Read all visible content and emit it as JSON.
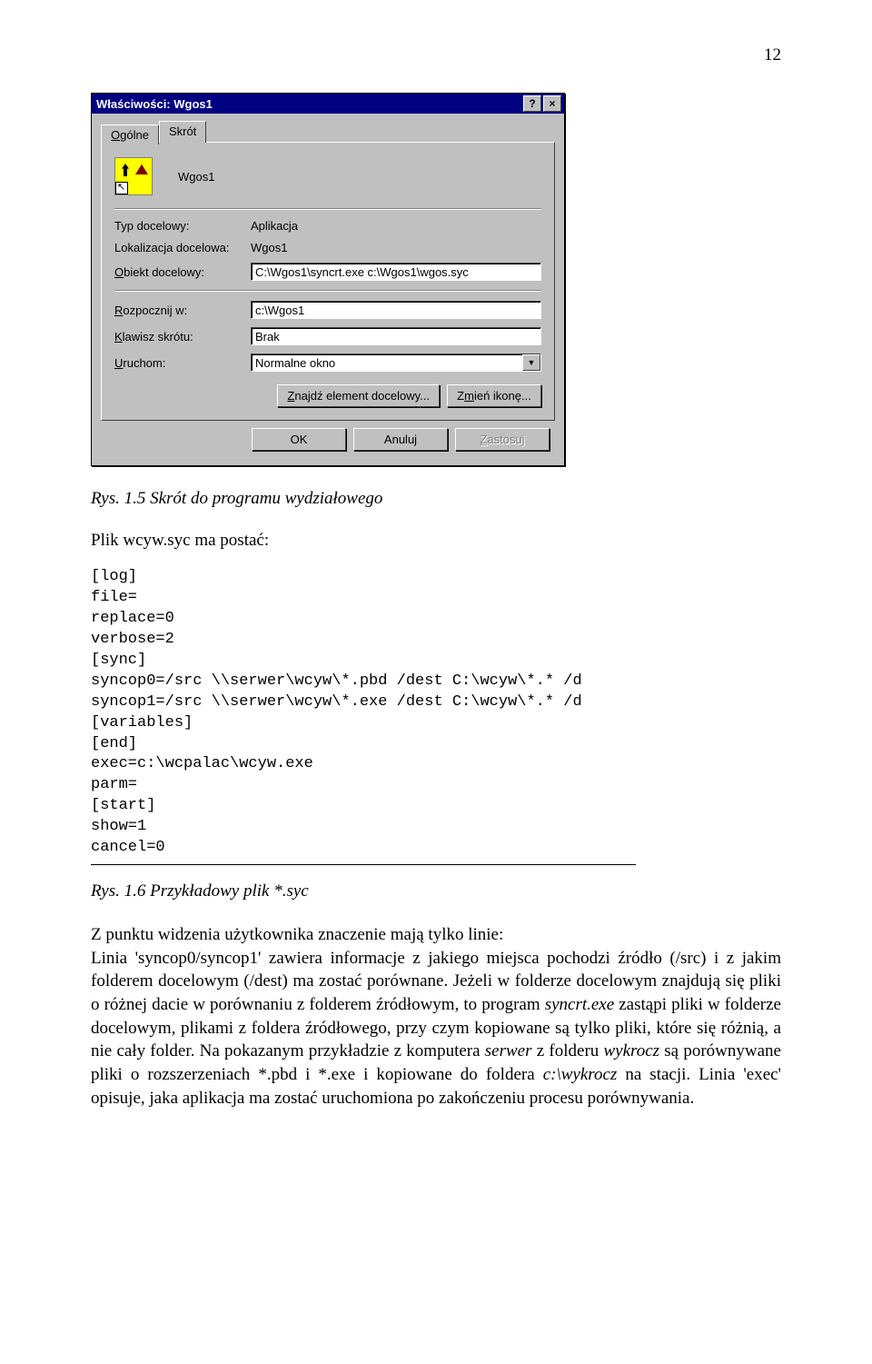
{
  "page_number": "12",
  "dialog": {
    "title": "Właściwości: Wgos1",
    "help_symbol": "?",
    "close_symbol": "×",
    "tabs": {
      "general": "Ogólne",
      "shortcut": "Skrót"
    },
    "app_name": "Wgos1",
    "rows": {
      "target_type_label": "Typ docelowy:",
      "target_type_value": "Aplikacja",
      "target_loc_label": "Lokalizacja docelowa:",
      "target_loc_value": "Wgos1",
      "target_obj_label": "Obiekt docelowy:",
      "target_obj_value": "C:\\Wgos1\\syncrt.exe c:\\Wgos1\\wgos.syc",
      "start_in_label": "Rozpocznij w:",
      "start_in_value": "c:\\Wgos1",
      "shortcut_key_label": "Klawisz skrótu:",
      "shortcut_key_value": "Brak",
      "run_label": "Uruchom:",
      "run_value": "Normalne okno"
    },
    "buttons": {
      "find_target": "Znajdź element docelowy...",
      "change_icon": "Zmień ikonę...",
      "ok": "OK",
      "cancel": "Anuluj",
      "apply": "Zastosuj"
    }
  },
  "caption1": "Rys. 1.5 Skrót do programu wydziałowego",
  "line_plik": "Plik wcyw.syc ma postać:",
  "code": "[log]\nfile=\nreplace=0\nverbose=2\n[sync]\nsyncop0=/src \\\\serwer\\wcyw\\*.pbd /dest C:\\wcyw\\*.* /d\nsyncop1=/src \\\\serwer\\wcyw\\*.exe /dest C:\\wcyw\\*.* /d\n[variables]\n[end]\nexec=c:\\wcpalac\\wcyw.exe\nparm=\n[start]\nshow=1\ncancel=0",
  "caption2": "Rys. 1.6 Przykładowy plik *.syc",
  "para_parts": {
    "p1": "Z punktu widzenia użytkownika znaczenie mają tylko linie:",
    "p2": "Linia 'syncop0/syncop1' zawiera informacje z jakiego miejsca pochodzi źródło (/src) i z jakim folderem docelowym (/dest) ma zostać porównane. Jeżeli w folderze docelowym znajdują się pliki o różnej dacie w porównaniu z folderem źródłowym, to program ",
    "p3": "syncrt.exe",
    "p4": " zastąpi pliki w folderze docelowym, plikami z foldera źródłowego, przy czym kopiowane są tylko pliki, które się różnią, a nie cały folder. Na pokazanym przykładzie z komputera ",
    "p5": "serwer",
    "p6": " z folderu ",
    "p7": "wykrocz",
    "p8": " są porównywane pliki o rozszerzeniach *.pbd i *.exe i kopiowane do foldera ",
    "p9": "c:\\wykrocz",
    "p10": " na stacji. Linia 'exec' opisuje, jaka aplikacja ma zostać uruchomiona po zakończeniu procesu porównywania."
  }
}
